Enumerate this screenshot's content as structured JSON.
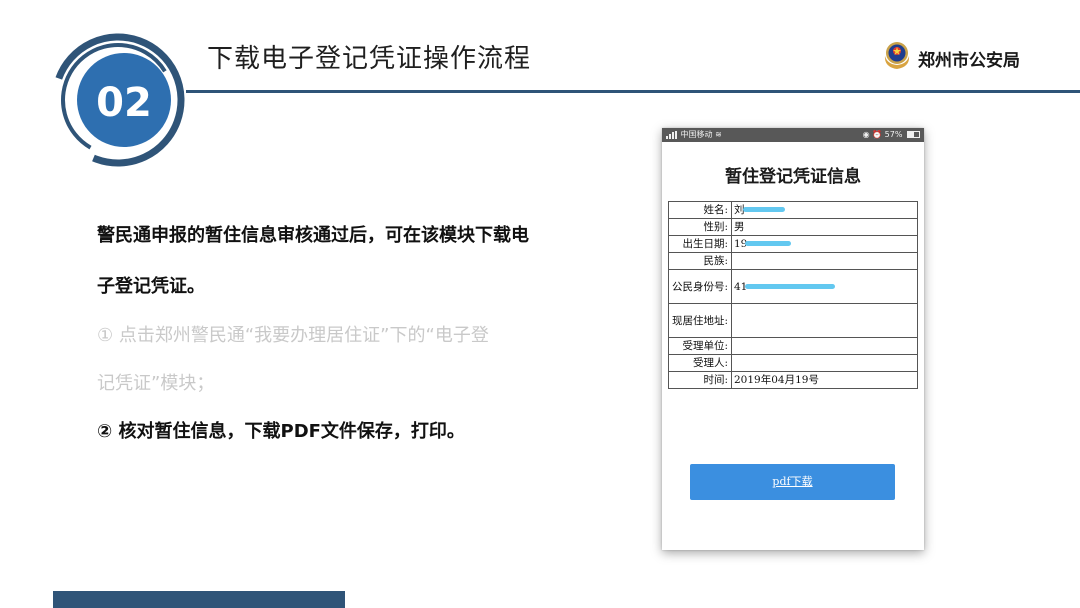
{
  "header": {
    "step_number": "02",
    "title": "下载电子登记凭证操作流程",
    "org_name": "郑州市公安局"
  },
  "body": {
    "line1": "警民通申报的暂住信息审核通过后，可在该模块下载电",
    "line2": "子登记凭证。",
    "line3": "① 点击郑州警民通“我要办理居住证”下的“电子登",
    "line4": "记凭证”模块；",
    "line5": "② 核对暂住信息，下载PDF文件保存，打印。"
  },
  "phone": {
    "status": {
      "carrier": "中国移动",
      "battery": "57%",
      "battery_level": 0.57
    },
    "title": "暂住登记凭证信息",
    "rows": [
      {
        "label": "姓名:",
        "value": "刘"
      },
      {
        "label": "性别:",
        "value": "男"
      },
      {
        "label": "出生日期:",
        "value": "19"
      },
      {
        "label": "民族:",
        "value": ""
      },
      {
        "label": "公民身份号:",
        "value": "41"
      },
      {
        "label": "现居住地址:",
        "value": ""
      },
      {
        "label": "受理单位:",
        "value": ""
      },
      {
        "label": "受理人:",
        "value": ""
      },
      {
        "label": "时间:",
        "value": "2019年04月19号"
      }
    ],
    "download_label": "pdf下载"
  },
  "colors": {
    "accent_navy": "#2f5478",
    "badge_blue": "#2e6fb0",
    "button_blue": "#3b8fe0",
    "scribble": "#63c8f0"
  }
}
